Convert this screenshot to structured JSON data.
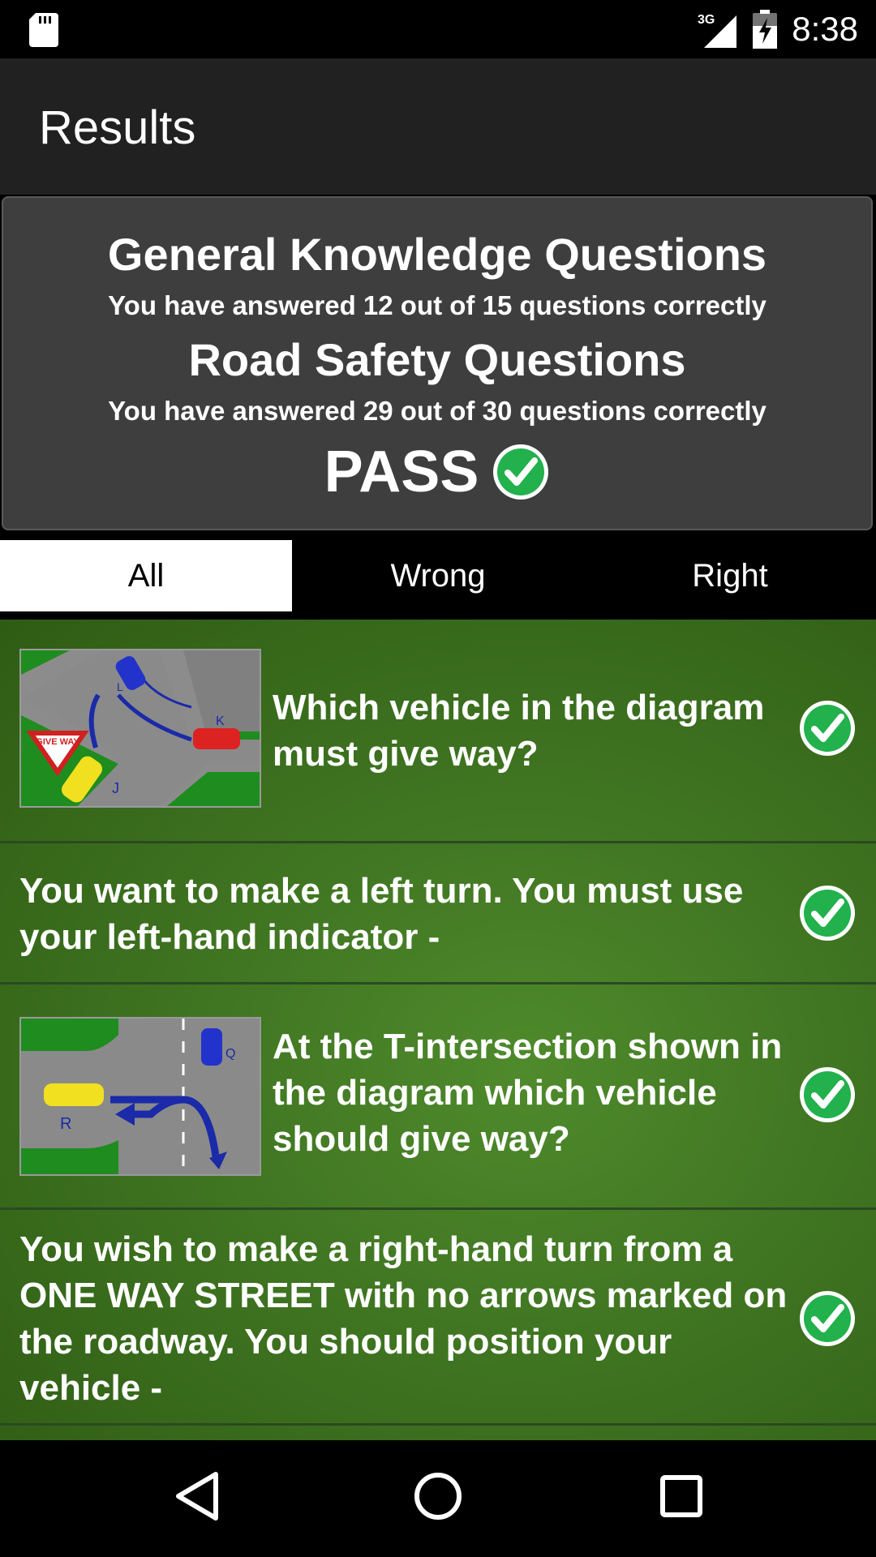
{
  "status_bar": {
    "time": "8:38",
    "network": "3G"
  },
  "app_bar": {
    "title": "Results"
  },
  "summary": {
    "section1_title": "General Knowledge Questions",
    "section1_result": "You have answered 12 out of 15 questions correctly",
    "section2_title": "Road Safety Questions",
    "section2_result": "You have answered 29 out of 30 questions correctly",
    "verdict": "PASS"
  },
  "tabs": [
    {
      "label": "All",
      "active": true
    },
    {
      "label": "Wrong",
      "active": false
    },
    {
      "label": "Right",
      "active": false
    }
  ],
  "questions": [
    {
      "text": "Which vehicle in the diagram must give way?",
      "has_image": true,
      "image_name": "give-way-intersection-diagram",
      "correct": true
    },
    {
      "text": "You want to make a left turn. You must use your left-hand indicator -",
      "has_image": false,
      "correct": true
    },
    {
      "text": "At the T-intersection shown in the diagram which vehicle should give way?",
      "has_image": true,
      "image_name": "t-intersection-diagram",
      "correct": true
    },
    {
      "text": "You wish to make a right-hand turn from a ONE WAY STREET with no arrows marked on the roadway. You should position your vehicle -",
      "has_image": false,
      "correct": true
    }
  ],
  "diagram1": {
    "sign_text": "GIVE WAY",
    "labels": [
      "L",
      "K",
      "J"
    ]
  },
  "diagram2": {
    "labels": [
      "Q",
      "R"
    ]
  },
  "colors": {
    "pass_green": "#22b14c",
    "list_green": "#3f7421",
    "app_bar": "#212121"
  }
}
